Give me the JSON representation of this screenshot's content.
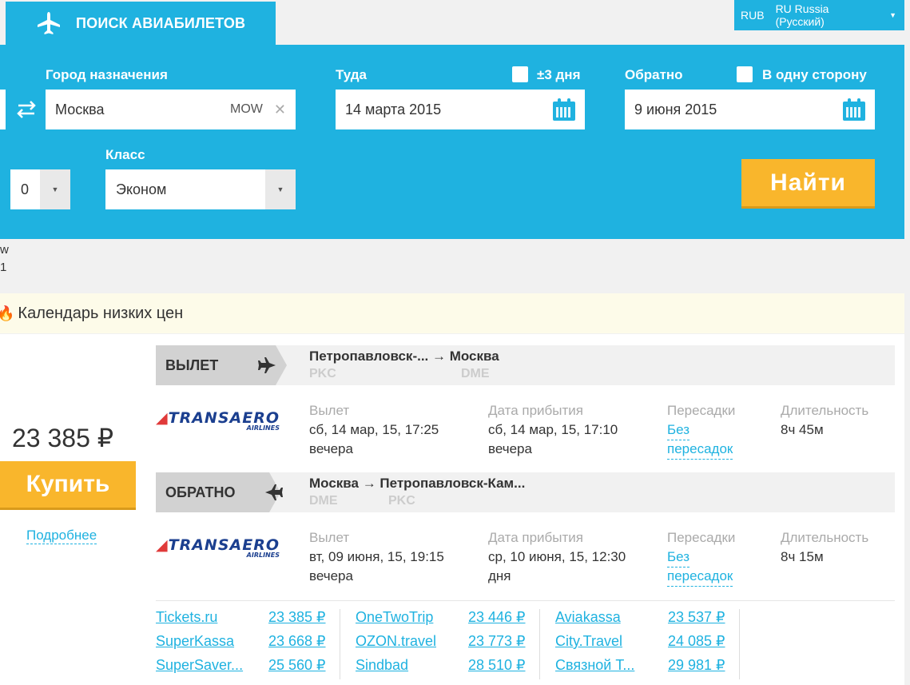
{
  "header": {
    "tab_label": "ПОИСК АВИАБИЛЕТОВ",
    "currency": "RUB",
    "language": "RU Russia (Русский)"
  },
  "search": {
    "destination_label": "Город назначения",
    "destination_value": "Москва",
    "destination_code": "MOW",
    "depart_label": "Туда",
    "flex_label": "±3 дня",
    "depart_value": "14 марта 2015",
    "return_label": "Обратно",
    "oneway_label": "В одну сторону",
    "return_value": "9 июня 2015",
    "class_label": "Класс",
    "class_value": "Эконом",
    "passengers_value": "0",
    "find_label": "Найти"
  },
  "left_fragment": {
    "line1": "w",
    "line2": "1"
  },
  "calendar_banner": "Календарь низких цен",
  "offer": {
    "price": "23 385 ₽",
    "buy_label": "Купить",
    "more_label": "Подробнее",
    "segments": [
      {
        "tag": "ВЫЛЕТ",
        "route": "Петропавловск-... → Москва",
        "from_code": "PKC",
        "to_code": "DME",
        "airline": "TRANSAERO",
        "airline_sub": "AIRLINES",
        "depart_label": "Вылет",
        "depart_value": "сб, 14 мар, 15, 17:25",
        "depart_part": "вечера",
        "arrive_label": "Дата прибытия",
        "arrive_value": "сб, 14 мар, 15, 17:10",
        "arrive_part": "вечера",
        "stops_label": "Пересадки",
        "stops_value1": "Без",
        "stops_value2": "пересадок",
        "duration_label": "Длительность",
        "duration_value": "8ч 45м"
      },
      {
        "tag": "ОБРАТНО",
        "route": "Москва → Петропавловск-Кам...",
        "from_code": "DME",
        "to_code": "PKC",
        "airline": "TRANSAERO",
        "airline_sub": "AIRLINES",
        "depart_label": "Вылет",
        "depart_value": "вт, 09 июня, 15, 19:15",
        "depart_part": "вечера",
        "arrive_label": "Дата прибытия",
        "arrive_value": "ср, 10 июня, 15, 12:30",
        "arrive_part": "дня",
        "stops_label": "Пересадки",
        "stops_value1": "Без",
        "stops_value2": "пересадок",
        "duration_label": "Длительность",
        "duration_value": "8ч 15м"
      }
    ],
    "agencies": [
      {
        "name": "Tickets.ru",
        "price": "23 385 ₽"
      },
      {
        "name": "SuperKassa",
        "price": "23 668 ₽"
      },
      {
        "name": "SuperSaver...",
        "price": "25 560 ₽"
      },
      {
        "name": "OneTwoTrip",
        "price": "23 446 ₽"
      },
      {
        "name": "OZON.travel",
        "price": "23 773 ₽"
      },
      {
        "name": "Sindbad",
        "price": "28 510 ₽"
      },
      {
        "name": "Aviakassa",
        "price": "23 537 ₽"
      },
      {
        "name": "City.Travel",
        "price": "24 085 ₽"
      },
      {
        "name": "Связной Т...",
        "price": "29 981 ₽"
      }
    ]
  },
  "colors": {
    "brand": "#1fb2e0",
    "accent": "#f9b62c"
  }
}
